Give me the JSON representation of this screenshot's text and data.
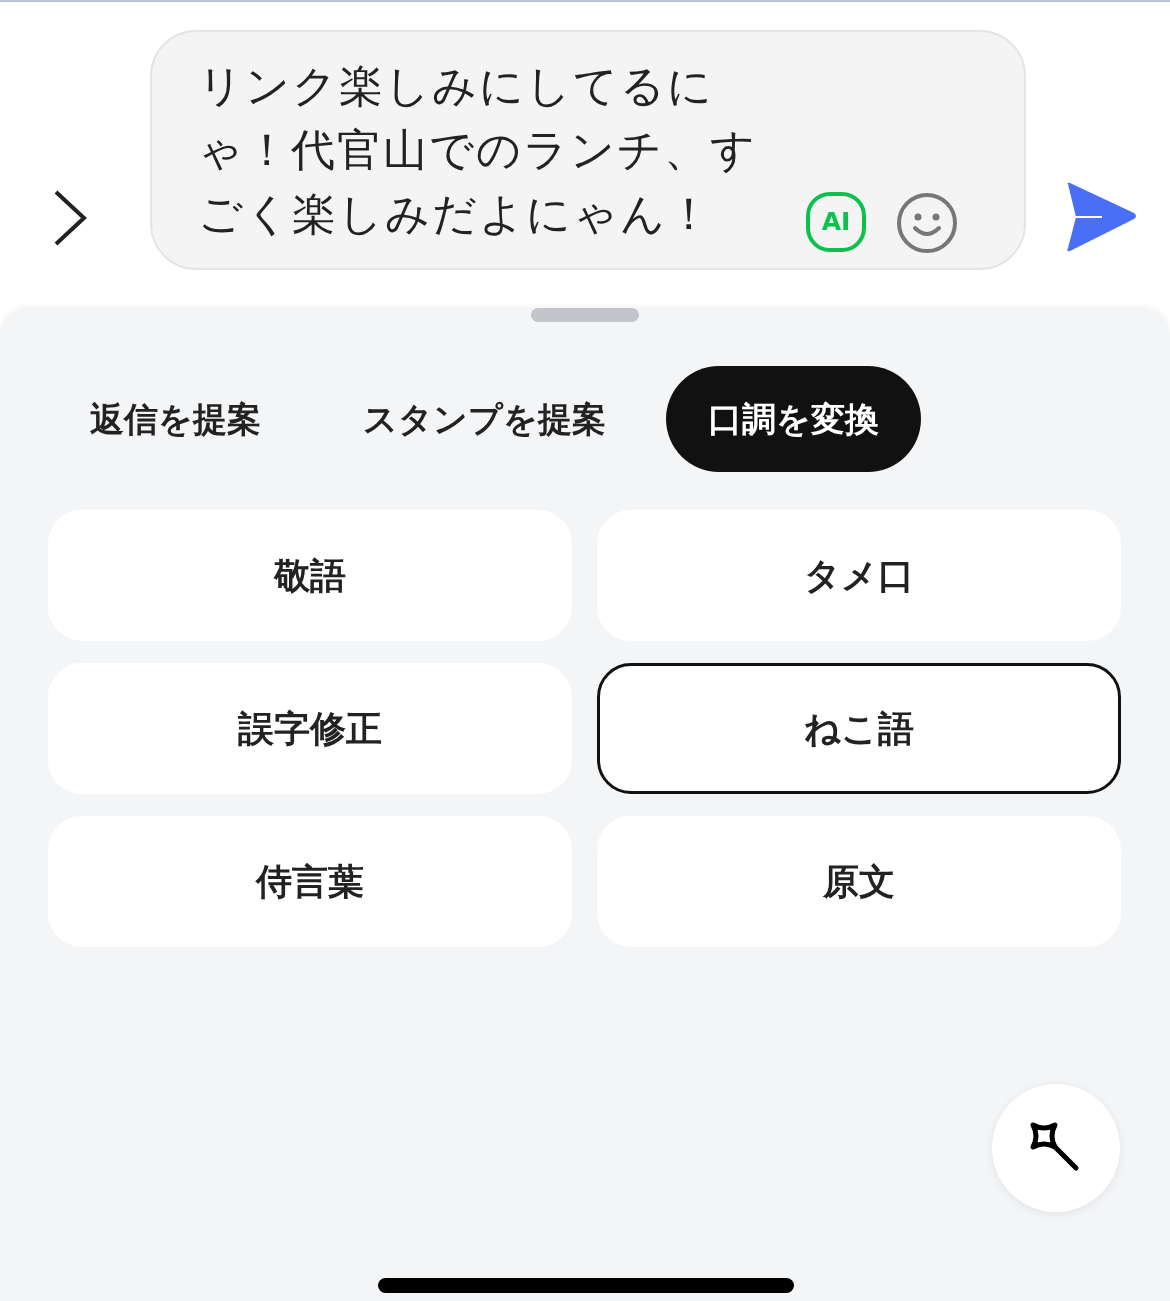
{
  "composer": {
    "message": "リンク楽しみにしてるにゃ！代官山でのランチ、すごく楽しみだよにゃん！",
    "ai_label": "AI"
  },
  "tabs": [
    {
      "label": "返信を提案",
      "selected": false
    },
    {
      "label": "スタンプを提案",
      "selected": false
    },
    {
      "label": "口調を変換",
      "selected": true
    }
  ],
  "options": [
    {
      "label": "敬語",
      "selected": false
    },
    {
      "label": "タメ口",
      "selected": false
    },
    {
      "label": "誤字修正",
      "selected": false
    },
    {
      "label": "ねこ語",
      "selected": true
    },
    {
      "label": "侍言葉",
      "selected": false
    },
    {
      "label": "原文",
      "selected": false
    }
  ]
}
